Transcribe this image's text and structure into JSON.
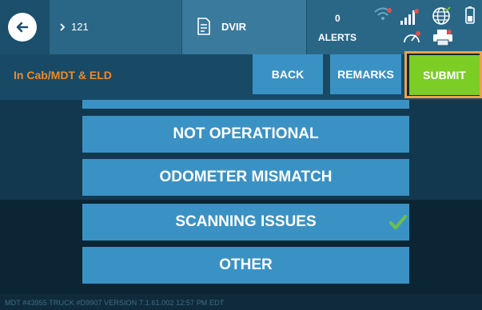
{
  "header": {
    "nav_text": "121",
    "dvir_label": "DVIR",
    "alerts_count": "0",
    "alerts_label": "ALERTS"
  },
  "subbar": {
    "mode_label": "In Cab/MDT & ELD",
    "back_label": "BACK",
    "remarks_label": "REMARKS",
    "submit_label": "SUBMIT"
  },
  "options": [
    {
      "label": "NOT OPERATIONAL",
      "checked": false
    },
    {
      "label": "ODOMETER MISMATCH",
      "checked": false
    },
    {
      "label": "SCANNING ISSUES",
      "checked": true
    },
    {
      "label": "OTHER",
      "checked": false
    }
  ],
  "footer": {
    "status_text": "MDT #43955   TRUCK #D9907   VERSION  7.1.61.002   12:57 PM EDT"
  },
  "icons": {
    "back": "arrow-left-icon",
    "nav": "chevron-right-icon",
    "dvir": "document-icon",
    "wifi": "wifi-icon",
    "signal": "signal-bars-icon",
    "globe": "globe-icon",
    "battery": "battery-icon",
    "gauge": "gauge-icon",
    "printer": "printer-icon",
    "check": "checkmark-icon"
  },
  "colors": {
    "accent_orange": "#f08a24",
    "submit_green": "#7ccd24",
    "button_blue": "#3a92c4",
    "check_green": "#6cc04a"
  }
}
